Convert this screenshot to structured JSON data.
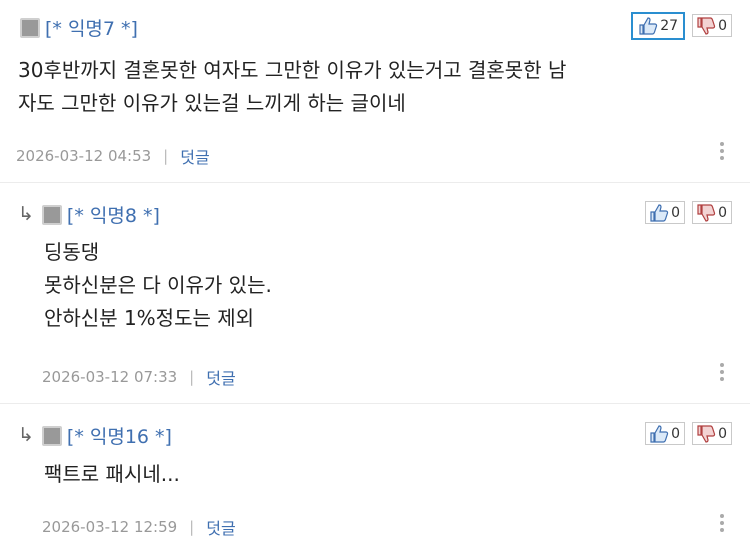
{
  "comments": [
    {
      "nick": "[* 익명7 *]",
      "likes": "27",
      "dislikes": "0",
      "body": "30후반까지 결혼못한 여자도 그만한 이유가 있는거고 결혼못한 남\n자도 그만한 이유가 있는걸 느끼게 하는 글이네",
      "date": "2026-03-12 04:53",
      "reply_label": "덧글"
    },
    {
      "nick": "[* 익명8 *]",
      "likes": "0",
      "dislikes": "0",
      "body": "딩동댕\n못하신분은 다 이유가 있는.\n안하신분 1%정도는 제외",
      "date": "2026-03-12 07:33",
      "reply_label": "덧글"
    },
    {
      "nick": "[* 익명16 *]",
      "likes": "0",
      "dislikes": "0",
      "body": "팩트로 패시네...",
      "date": "2026-03-12 12:59",
      "reply_label": "덧글"
    }
  ],
  "colors": {
    "nick": "#3f6fb0",
    "active_vote_border": "#2a8ed0",
    "meta": "#999999"
  },
  "icons": {
    "reply": "reply-arrow-icon",
    "like": "thumbs-up-icon",
    "dislike": "thumbs-down-icon",
    "more": "more-vertical-icon"
  }
}
